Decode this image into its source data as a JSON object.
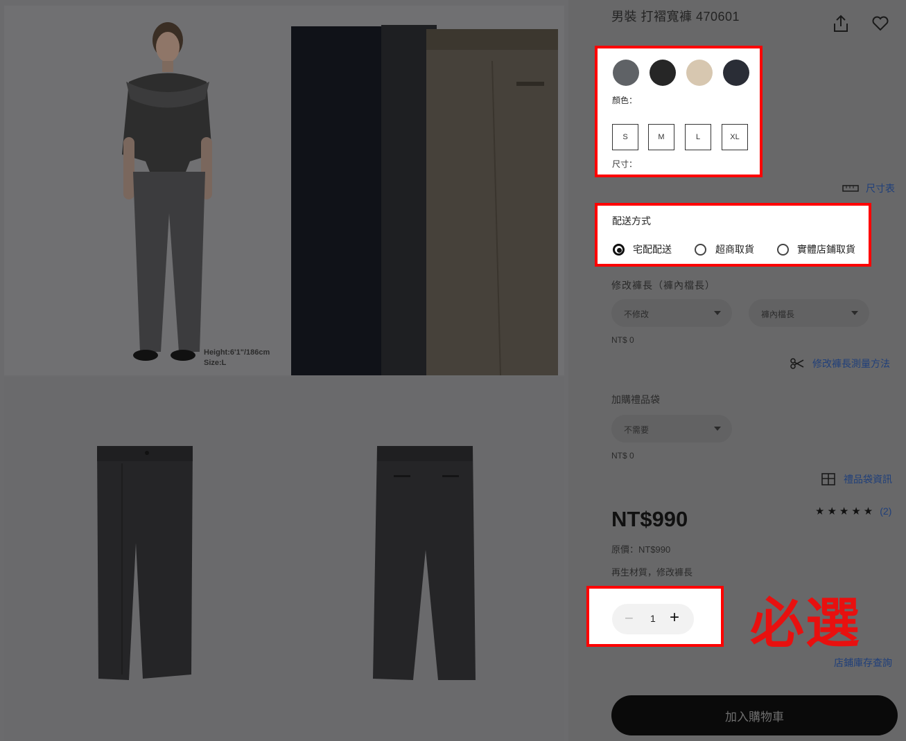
{
  "product": {
    "title": "男裝 打褶寬褲 470601",
    "model_height": "Height:6'1\"/186cm",
    "model_size": "Size:L"
  },
  "colors": {
    "label": "顏色：",
    "swatches": [
      "#5f6266",
      "#262626",
      "#d7c7b0",
      "#2a2d36"
    ]
  },
  "sizes": {
    "label": "尺寸：",
    "options": [
      "S",
      "M",
      "L",
      "XL"
    ]
  },
  "size_chart_link": "尺寸表",
  "delivery": {
    "heading": "配送方式",
    "options": [
      {
        "label": "宅配配送",
        "selected": true
      },
      {
        "label": "超商取貨",
        "selected": false
      },
      {
        "label": "實體店鋪取貨",
        "selected": false
      }
    ]
  },
  "hem": {
    "heading": "修改褲長（褲內檔長）",
    "select1": "不修改",
    "select2": "褲內檔長",
    "price": "NT$ 0",
    "how_to_link": "修改褲長測量方法"
  },
  "gift_bag": {
    "heading": "加購禮品袋",
    "select": "不需要",
    "price": "NT$ 0",
    "info_link": "禮品袋資訊"
  },
  "price": {
    "current": "NT$990",
    "original": "原價：NT$990",
    "tags": "再生材質，修改褲長"
  },
  "rating": {
    "stars": 5,
    "count": "(2)"
  },
  "quantity": {
    "minus": "−",
    "value": "1",
    "plus": "+"
  },
  "annotation": "必選",
  "store_stock_link": "店鋪庫存查詢",
  "add_to_cart": "加入購物車"
}
